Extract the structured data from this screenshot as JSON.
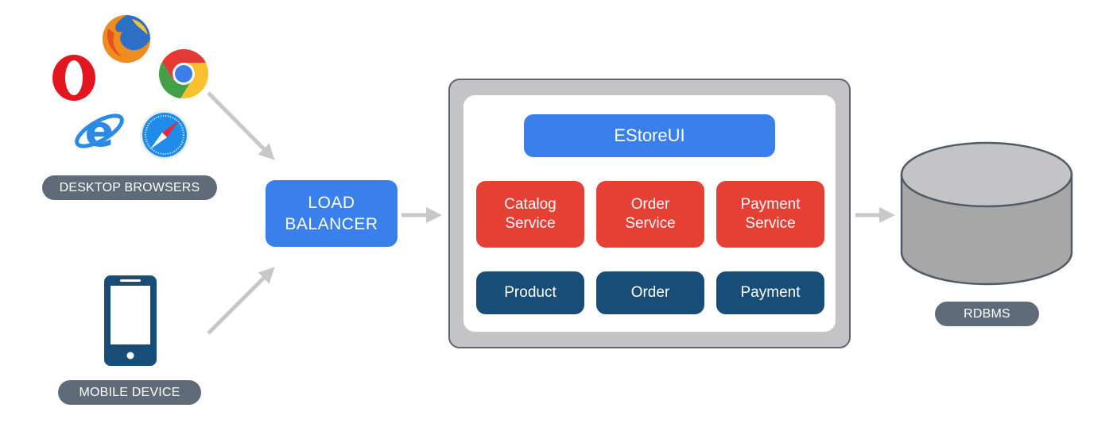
{
  "clients": {
    "desktop": {
      "label": "DESKTOP BROWSERS",
      "icons": [
        "firefox-icon",
        "opera-icon",
        "chrome-icon",
        "internet-explorer-icon",
        "safari-icon"
      ]
    },
    "mobile": {
      "label": "MOBILE DEVICE",
      "icon": "smartphone-icon"
    }
  },
  "load_balancer": {
    "line1": "LOAD",
    "line2": "BALANCER"
  },
  "app": {
    "ui": "EStoreUI",
    "services": [
      {
        "line1": "Catalog",
        "line2": "Service"
      },
      {
        "line1": "Order",
        "line2": "Service"
      },
      {
        "line1": "Payment",
        "line2": "Service"
      }
    ],
    "data_models": [
      "Product",
      "Order",
      "Payment"
    ]
  },
  "database": {
    "label": "RDBMS",
    "icon": "database-cylinder-icon"
  },
  "colors": {
    "primary_blue": "#3a80ec",
    "service_red": "#e63f33",
    "model_navy": "#184d77",
    "pill_gray": "#5f6b79",
    "arrow_gray": "#c8c8c8"
  }
}
